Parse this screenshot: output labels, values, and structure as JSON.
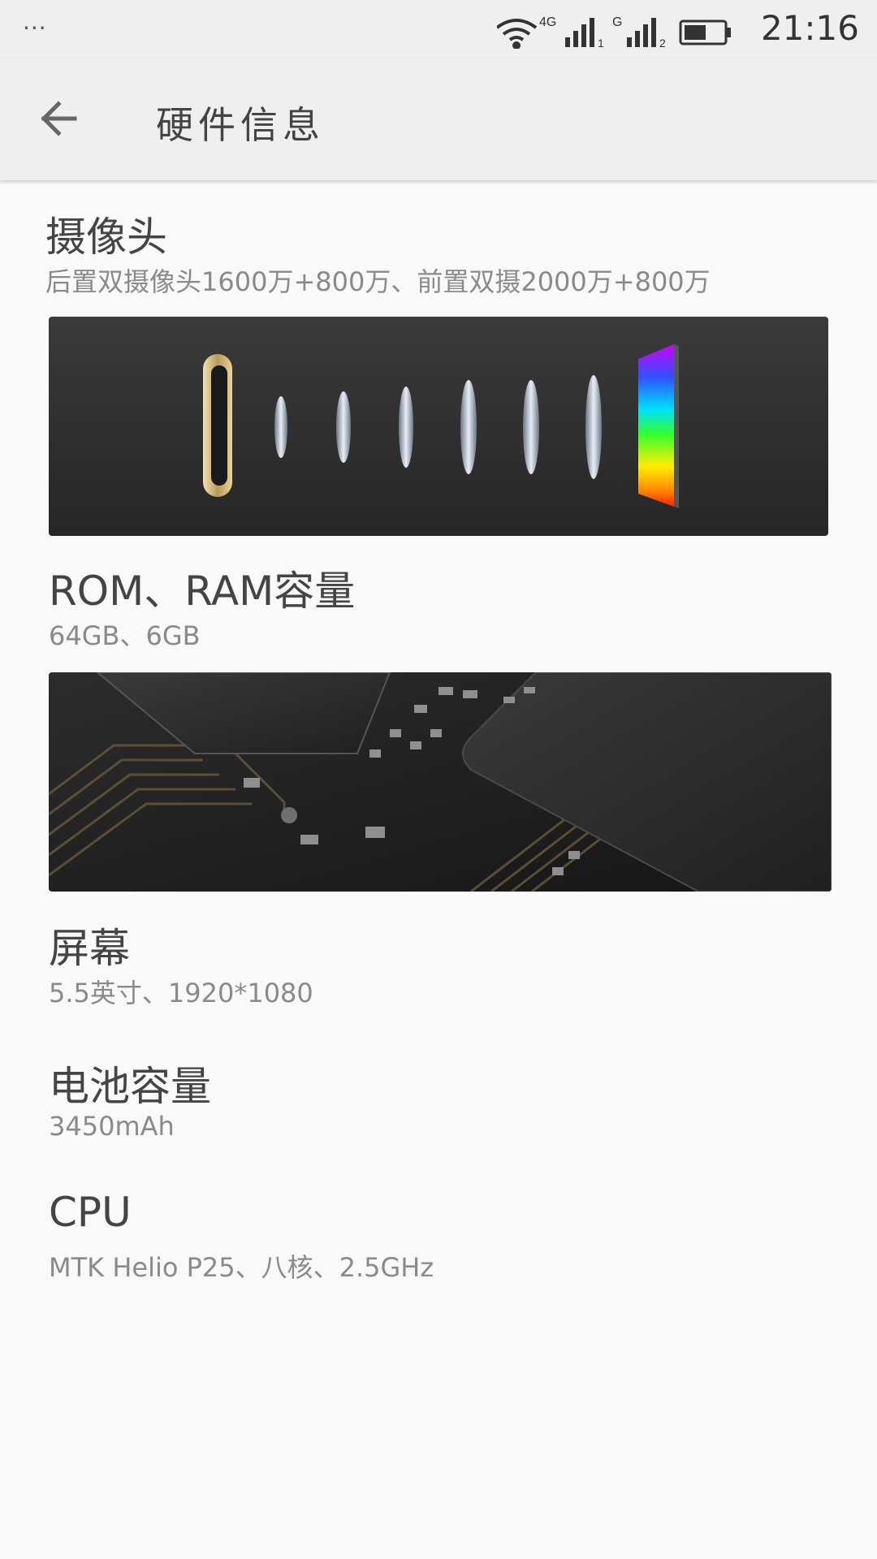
{
  "status_bar": {
    "more_indicator": "···",
    "network_1": "4G",
    "sim_1": "1",
    "network_2": "G",
    "sim_2": "2",
    "time": "21:16",
    "icons": [
      "wifi-icon",
      "signal-icon",
      "signal-icon",
      "battery-icon"
    ]
  },
  "app_bar": {
    "title": "硬件信息",
    "back_icon": "back-arrow-icon"
  },
  "sections": [
    {
      "title": "摄像头",
      "detail": "后置双摄像头1600万+800万、前置双摄2000万+800万"
    },
    {
      "title": "ROM、RAM容量",
      "detail": "64GB、6GB"
    },
    {
      "title": "屏幕",
      "detail": "5.5英寸、1920*1080"
    },
    {
      "title": "电池容量",
      "detail": "3450mAh"
    },
    {
      "title": "CPU",
      "detail": "MTK Helio P25、八核、2.5GHz"
    }
  ]
}
